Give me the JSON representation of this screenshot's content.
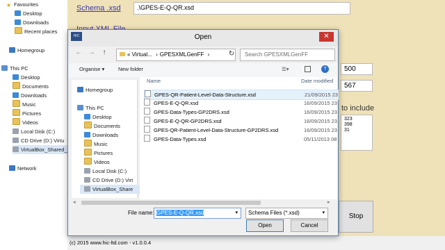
{
  "bg_nav": {
    "items": [
      {
        "label": "Favourites",
        "icon": "star-icon"
      },
      {
        "label": "Desktop",
        "icon": "desktop-icon"
      },
      {
        "label": "Downloads",
        "icon": "downloads-icon"
      },
      {
        "label": "Recent places",
        "icon": "recent-places-icon"
      },
      {
        "label": "Homegroup",
        "icon": "homegroup-icon"
      },
      {
        "label": "This PC",
        "icon": "pc-icon"
      },
      {
        "label": "Desktop",
        "icon": "desktop-icon"
      },
      {
        "label": "Documents",
        "icon": "folder-icon"
      },
      {
        "label": "Downloads",
        "icon": "downloads-icon"
      },
      {
        "label": "Music",
        "icon": "music-icon"
      },
      {
        "label": "Pictures",
        "icon": "pictures-icon"
      },
      {
        "label": "Videos",
        "icon": "videos-icon"
      },
      {
        "label": "Local Disk (C:)",
        "icon": "drive-icon"
      },
      {
        "label": "CD Drive (D:) Virtu",
        "icon": "cd-drive-icon"
      },
      {
        "label": "VirtualBox_Shared_",
        "icon": "network-drive-icon"
      },
      {
        "label": "Network",
        "icon": "network-icon"
      }
    ]
  },
  "app": {
    "schema_label": "Schema .xsd",
    "schema_value": ".\\GPES-E-Q-QR.xsd",
    "input_xml_label": "Input XML File",
    "value_500": "500",
    "value_567": "567",
    "include_text": "to include",
    "list_values": [
      "323",
      "398",
      "31"
    ],
    "stop_label": "Stop",
    "status": "(c) 2015 www.hic-ltd.com - v1.0.0.4"
  },
  "dialog": {
    "logo": "HIC",
    "title": "Open",
    "close_glyph": "✕",
    "address": [
      "«  Virtual...",
      "›",
      "GPESXMLGenFF",
      "›"
    ],
    "search_placeholder": "Search GPESXMLGenFF",
    "organise": "Organise ▾",
    "new_folder": "New folder",
    "col_name": "Name",
    "col_date": "Date modified",
    "nav": [
      {
        "label": "Homegroup"
      },
      {
        "label": "This PC"
      },
      {
        "label": "Desktop"
      },
      {
        "label": "Documents"
      },
      {
        "label": "Downloads"
      },
      {
        "label": "Music"
      },
      {
        "label": "Pictures"
      },
      {
        "label": "Videos"
      },
      {
        "label": "Local Disk (C:)"
      },
      {
        "label": "CD Drive (D:) Virt"
      },
      {
        "label": "VirtualBox_Share"
      }
    ],
    "files": [
      {
        "name": "GPES-QR-Patient-Level-Data-Structure.xsd",
        "date": "21/09/2015 23"
      },
      {
        "name": "GPES-E-Q-QR.xsd",
        "date": "16/09/2015 23"
      },
      {
        "name": "GPES-Data-Types-GP2DRS.xsd",
        "date": "16/09/2015 23"
      },
      {
        "name": "GPES-E-Q-QR-GP2DRS.xsd",
        "date": "16/09/2015 23"
      },
      {
        "name": "GPES-QR-Patient-Level-Data-Structure-GP2DRS.xsd",
        "date": "16/09/2015 23"
      },
      {
        "name": "GPES-Data-Types.xsd",
        "date": "05/11/2013 08"
      }
    ],
    "file_name_label": "File name:",
    "file_name_value": "GPES-E-Q-QR.xsd",
    "filter_value": "Schema Files (*.xsd)",
    "open_label": "Open",
    "cancel_label": "Cancel"
  },
  "colors": {
    "app_bg": "#efe2b8",
    "selection": "#3399ff",
    "close": "#c7372f"
  }
}
